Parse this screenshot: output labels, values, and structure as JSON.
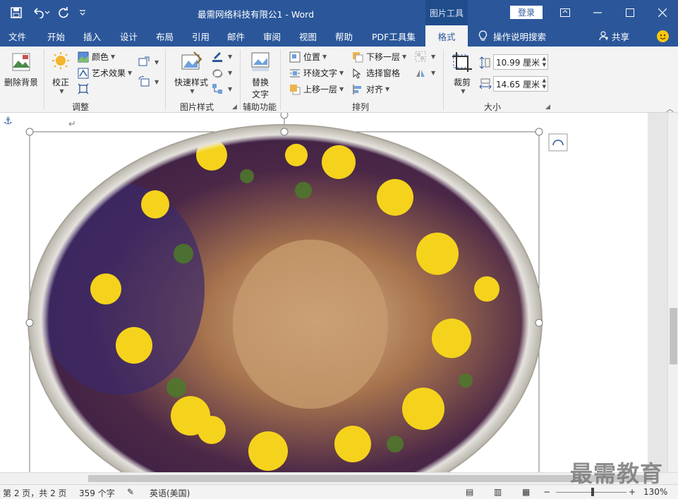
{
  "titlebar": {
    "title": "最需网络科技有限公1  -  Word",
    "context_tab": "图片工具",
    "login": "登录"
  },
  "tabs": [
    "文件",
    "开始",
    "插入",
    "设计",
    "布局",
    "引用",
    "邮件",
    "审阅",
    "视图",
    "帮助",
    "PDF工具集",
    "格式"
  ],
  "active_tab": "格式",
  "tell_me": "操作说明搜索",
  "share": "共享",
  "ribbon": {
    "remove_bg": "删除背景",
    "correct": "校正",
    "color": "颜色",
    "art_effects": "艺术效果",
    "group_adjust": "调整",
    "quick_styles": "快速样式",
    "group_picture_styles": "图片样式",
    "alt_text": "替换\n文字",
    "alt_text_line1": "替换",
    "alt_text_line2": "文字",
    "group_accessibility": "辅助功能",
    "position": "位置",
    "wrap_text": "环绕文字",
    "bring_forward": "上移一层",
    "send_backward": "下移一层",
    "selection_pane": "选择窗格",
    "align": "对齐",
    "group_arrange": "排列",
    "crop": "裁剪",
    "height": "10.99 厘米",
    "width": "14.65 厘米",
    "group_size": "大小"
  },
  "status": {
    "page": "第 2 页，共 2 页",
    "words": "359 个字",
    "language": "英语(美国)",
    "zoom": "130%"
  },
  "watermark": "最需教育",
  "colors": {
    "brand": "#2b579a",
    "ribbon_bg": "#f3f3f3"
  }
}
